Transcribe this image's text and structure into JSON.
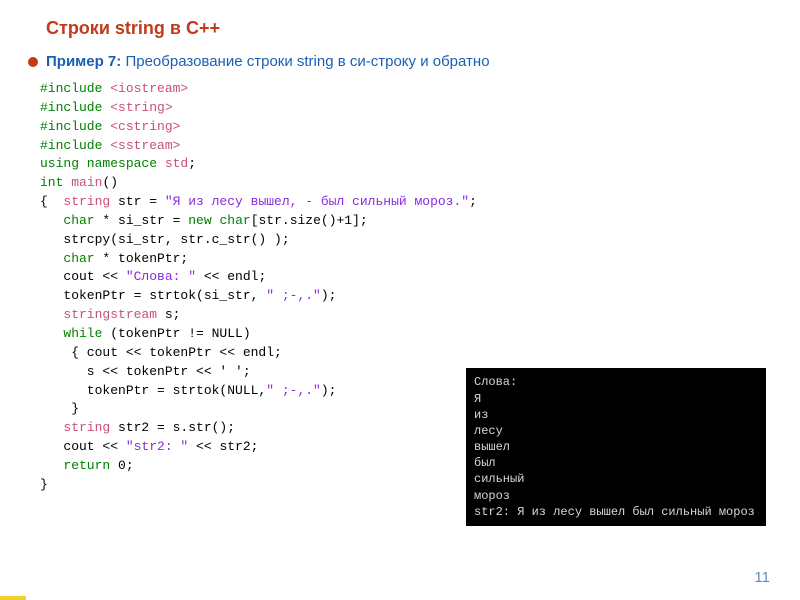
{
  "title": "Строки  string в С++",
  "example_label": "Пример 7:",
  "example_text": " Преобразование строки string в си-строку и обратно",
  "code": {
    "l01a": "#include ",
    "l01b": "<iostream>",
    "l02a": "#include ",
    "l02b": "<string>",
    "l03a": "#include ",
    "l03b": "<cstring>",
    "l04a": "#include ",
    "l04b": "<sstream>",
    "l05a": "using namespace ",
    "l05b": "std",
    "l05c": ";",
    "l06a": "int ",
    "l06b": "main",
    "l06c": "()",
    "l07a": "{  ",
    "l07b": "string ",
    "l07c": "str = ",
    "l07d": "\"Я из лесу вышел, - был сильный мороз.\"",
    "l07e": ";",
    "l08a": "   ",
    "l08b": "char ",
    "l08c": "* si_str = ",
    "l08d": "new ",
    "l08e": "char",
    "l08f": "[str.size()+1];",
    "l09a": "   strcpy(si_str, str.c_str() );",
    "l10a": "   ",
    "l10b": "char ",
    "l10c": "* tokenPtr;",
    "l11a": "   cout << ",
    "l11b": "\"Слова: \"",
    "l11c": " << endl;",
    "l12a": "   tokenPtr = strtok(si_str, ",
    "l12b": "\" ;-,.\"",
    "l12c": ");",
    "l13a": "   ",
    "l13b": "stringstream ",
    "l13c": "s;",
    "l14a": "   ",
    "l14b": "while ",
    "l14c": "(tokenPtr != NULL)",
    "l15a": "    { cout << tokenPtr << endl;",
    "l16a": "      s << tokenPtr << ' ';",
    "l17a": "      tokenPtr = strtok(NULL,",
    "l17b": "\" ;-,.\"",
    "l17c": ");",
    "l18a": "    }",
    "l19a": "   ",
    "l19b": "string ",
    "l19c": "str2 = s.str();",
    "l20a": "   cout << ",
    "l20b": "\"str2: \"",
    "l20c": " << str2;",
    "l21a": "   ",
    "l21b": "return ",
    "l21c": "0;",
    "l22a": "}"
  },
  "output": "Слова:\nЯ\nиз\nлесу\nвышел\nбыл\nсильный\nмороз\nstr2: Я из лесу вышел был сильный мороз",
  "pagenum": "11"
}
